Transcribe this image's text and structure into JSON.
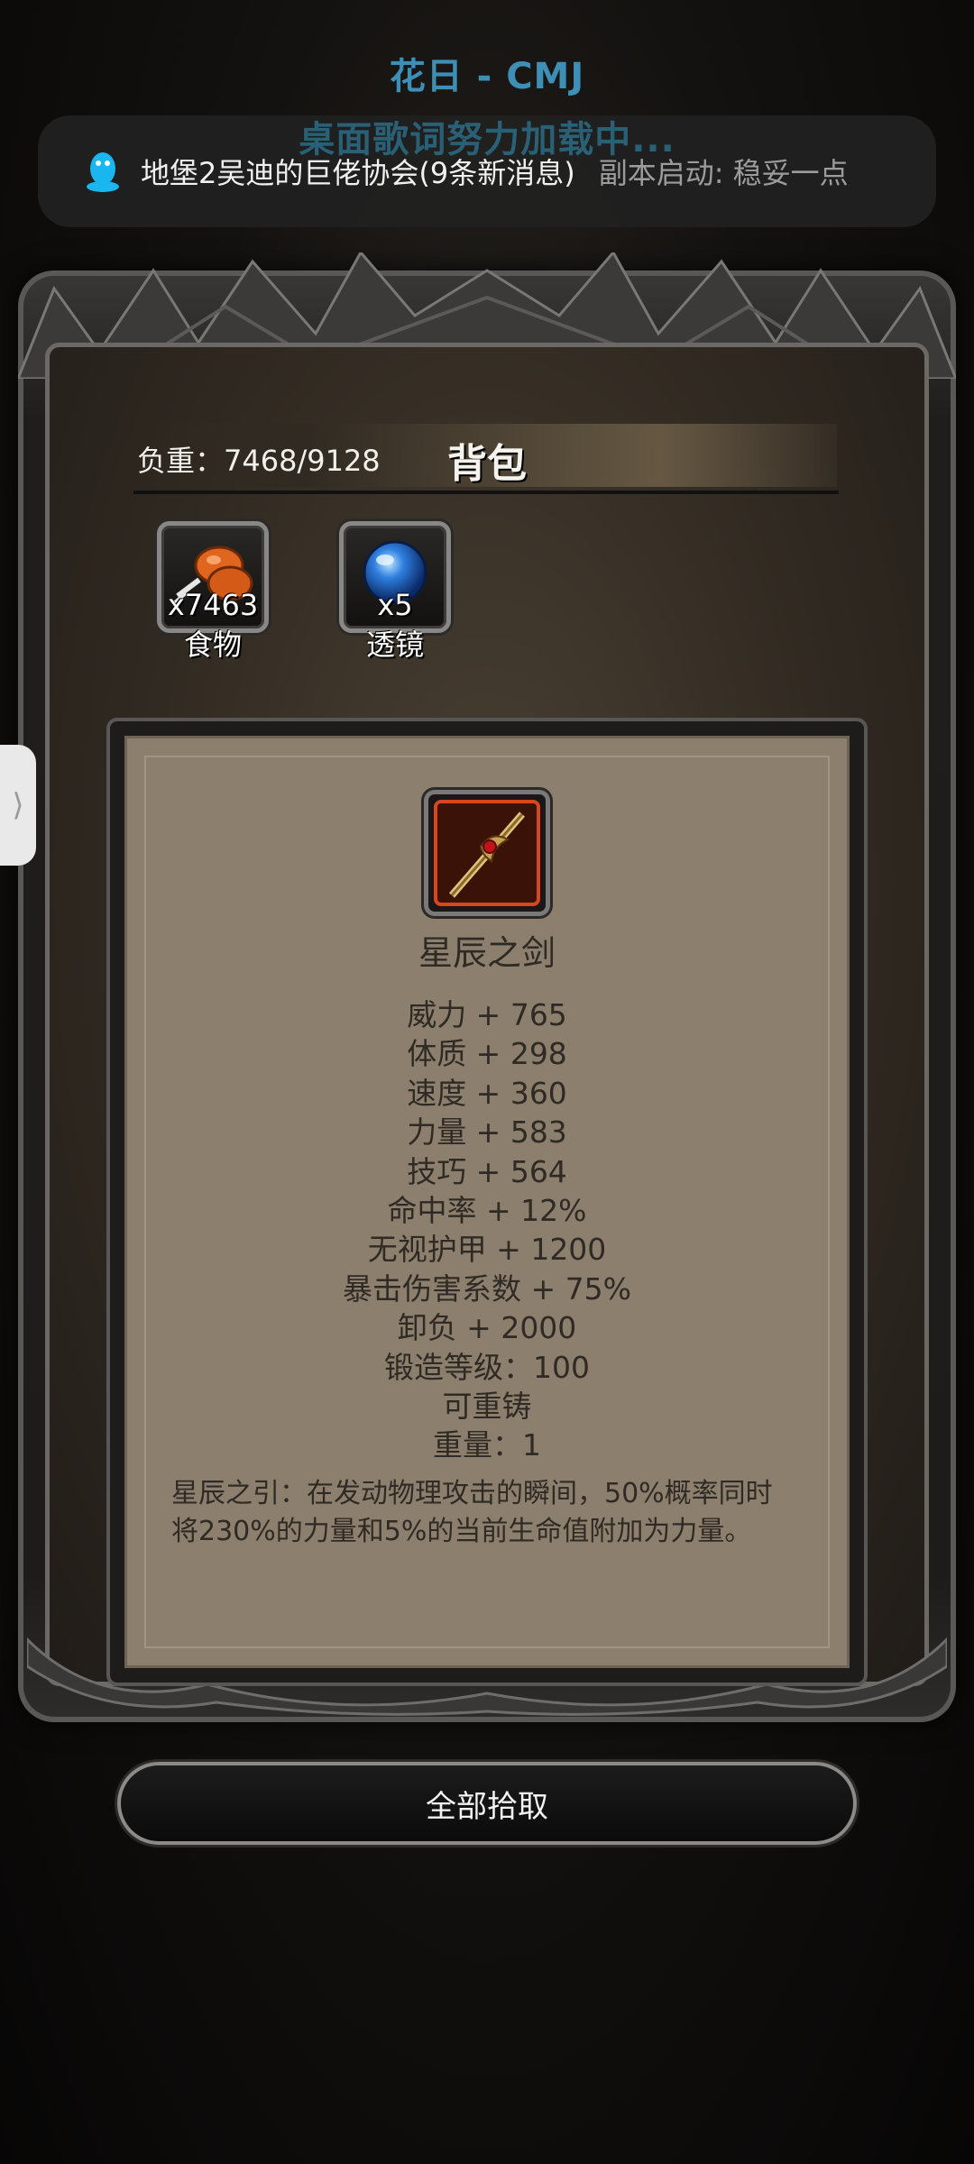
{
  "overlay": {
    "lyric_title": "花日 - CMJ",
    "lyric_loading": "桌面歌词努力加载中..."
  },
  "notification": {
    "icon": "qq-penguin-icon",
    "group_text": "地堡2吴迪的巨佬协会(9条新消息)",
    "status_text": "副本启动: 稳妥一点"
  },
  "bag": {
    "load_text": "负重：7468/9128",
    "title": "背包",
    "items": [
      {
        "icon": "food-icon",
        "count": "x7463",
        "name": "食物"
      },
      {
        "icon": "lens-icon",
        "count": "x5",
        "name": "透镜"
      }
    ]
  },
  "detail": {
    "icon": "star-sword-icon",
    "name": "星辰之剑",
    "stats": [
      "威力 + 765",
      "体质 + 298",
      "速度 + 360",
      "力量 + 583",
      "技巧 + 564",
      "命中率 + 12%",
      "无视护甲 + 1200",
      "暴击伤害系数 + 75%",
      "卸负 + 2000",
      "锻造等级：100",
      "可重铸",
      "重量：1"
    ],
    "description_line1": "星辰之引：在发动物理攻击的瞬间，50%概率同时",
    "description_line2": "将230%的力量和5%的当前生命值附加为力量。"
  },
  "actions": {
    "pickup_all": "全部拾取"
  },
  "side_handle": {
    "glyph": "⟩"
  },
  "colors": {
    "lyric_blue": "#3e8fb6",
    "paper": "#8c7f6d",
    "text_dark": "#2f2a24"
  }
}
